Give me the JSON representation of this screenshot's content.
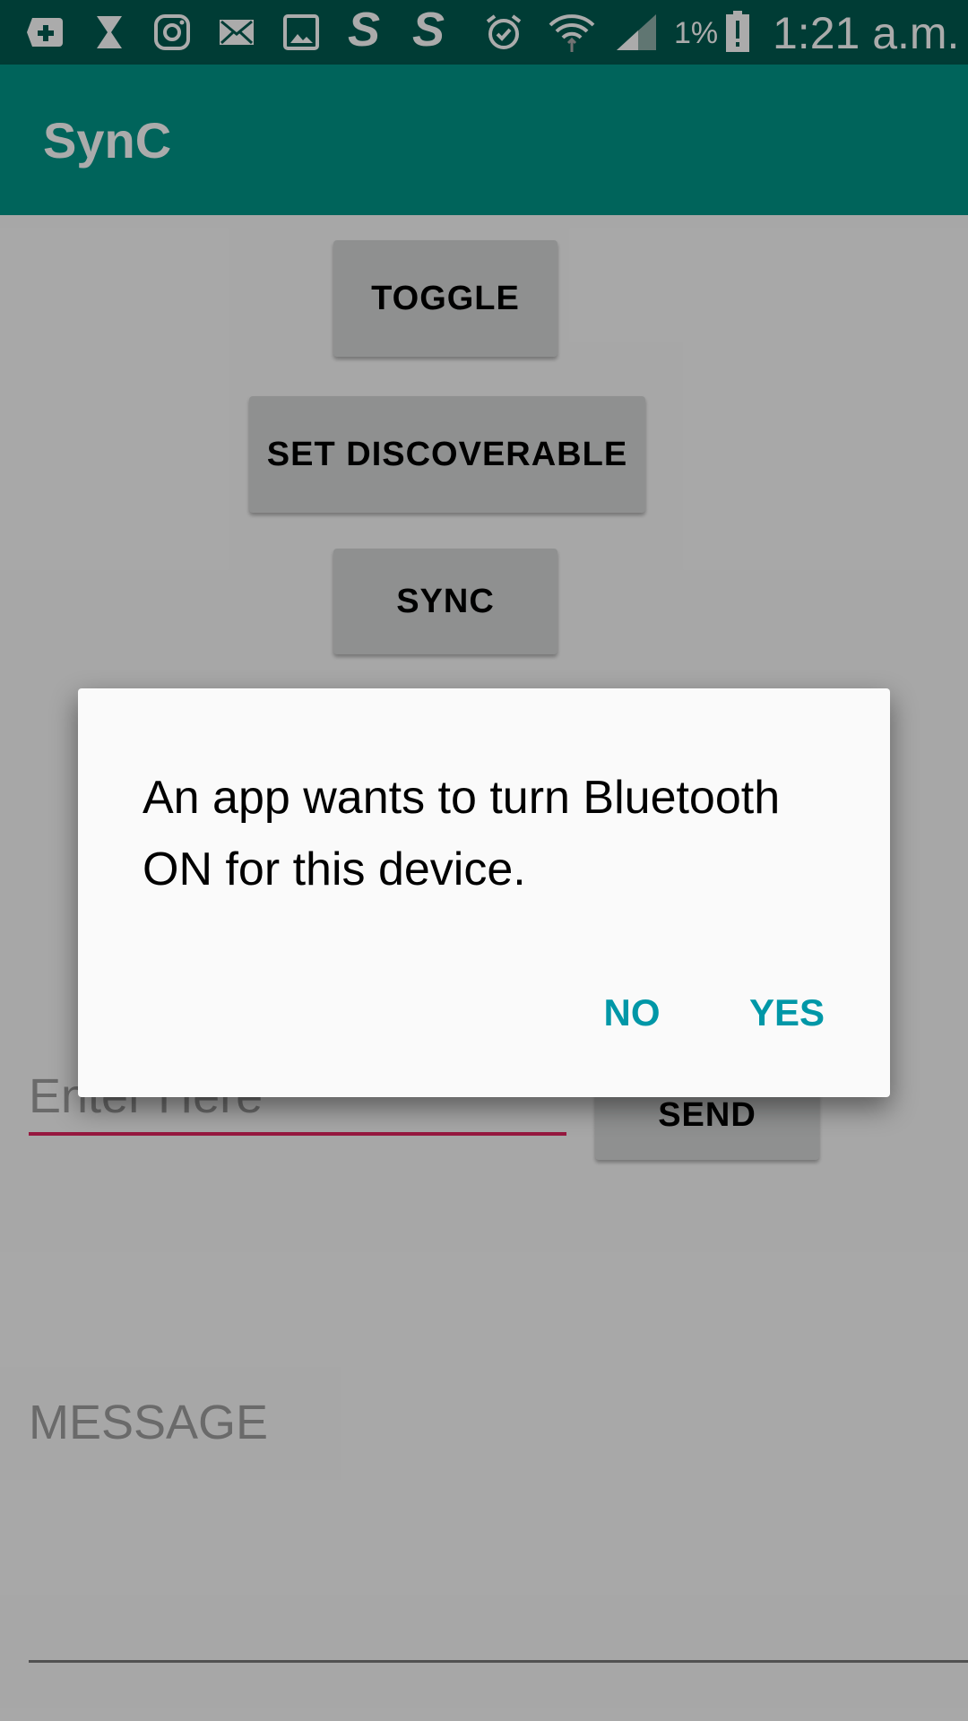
{
  "status_bar": {
    "icons": [
      "plus-square-icon",
      "hourglass-icon",
      "instagram-icon",
      "mail-icon",
      "image-icon",
      "s-app-icon",
      "s-app-icon-2",
      "alarm-icon",
      "wifi-icon",
      "signal-icon",
      "battery-icon"
    ],
    "battery_percent": "1%",
    "time": "1:21 a.m.",
    "background": "#005a50"
  },
  "app_bar": {
    "title": "SynC",
    "color": "#009688"
  },
  "buttons": {
    "toggle": "TOGGLE",
    "set_discoverable": "SET DISCOVERABLE",
    "sync": "SYNC",
    "send": "SEND"
  },
  "input": {
    "placeholder": "Enter Here"
  },
  "message": {
    "label": "MESSAGE"
  },
  "dialog": {
    "text": "An app wants to turn Bluetooth ON for this device.",
    "no": "NO",
    "yes": "YES",
    "accent": "#0097a7"
  }
}
